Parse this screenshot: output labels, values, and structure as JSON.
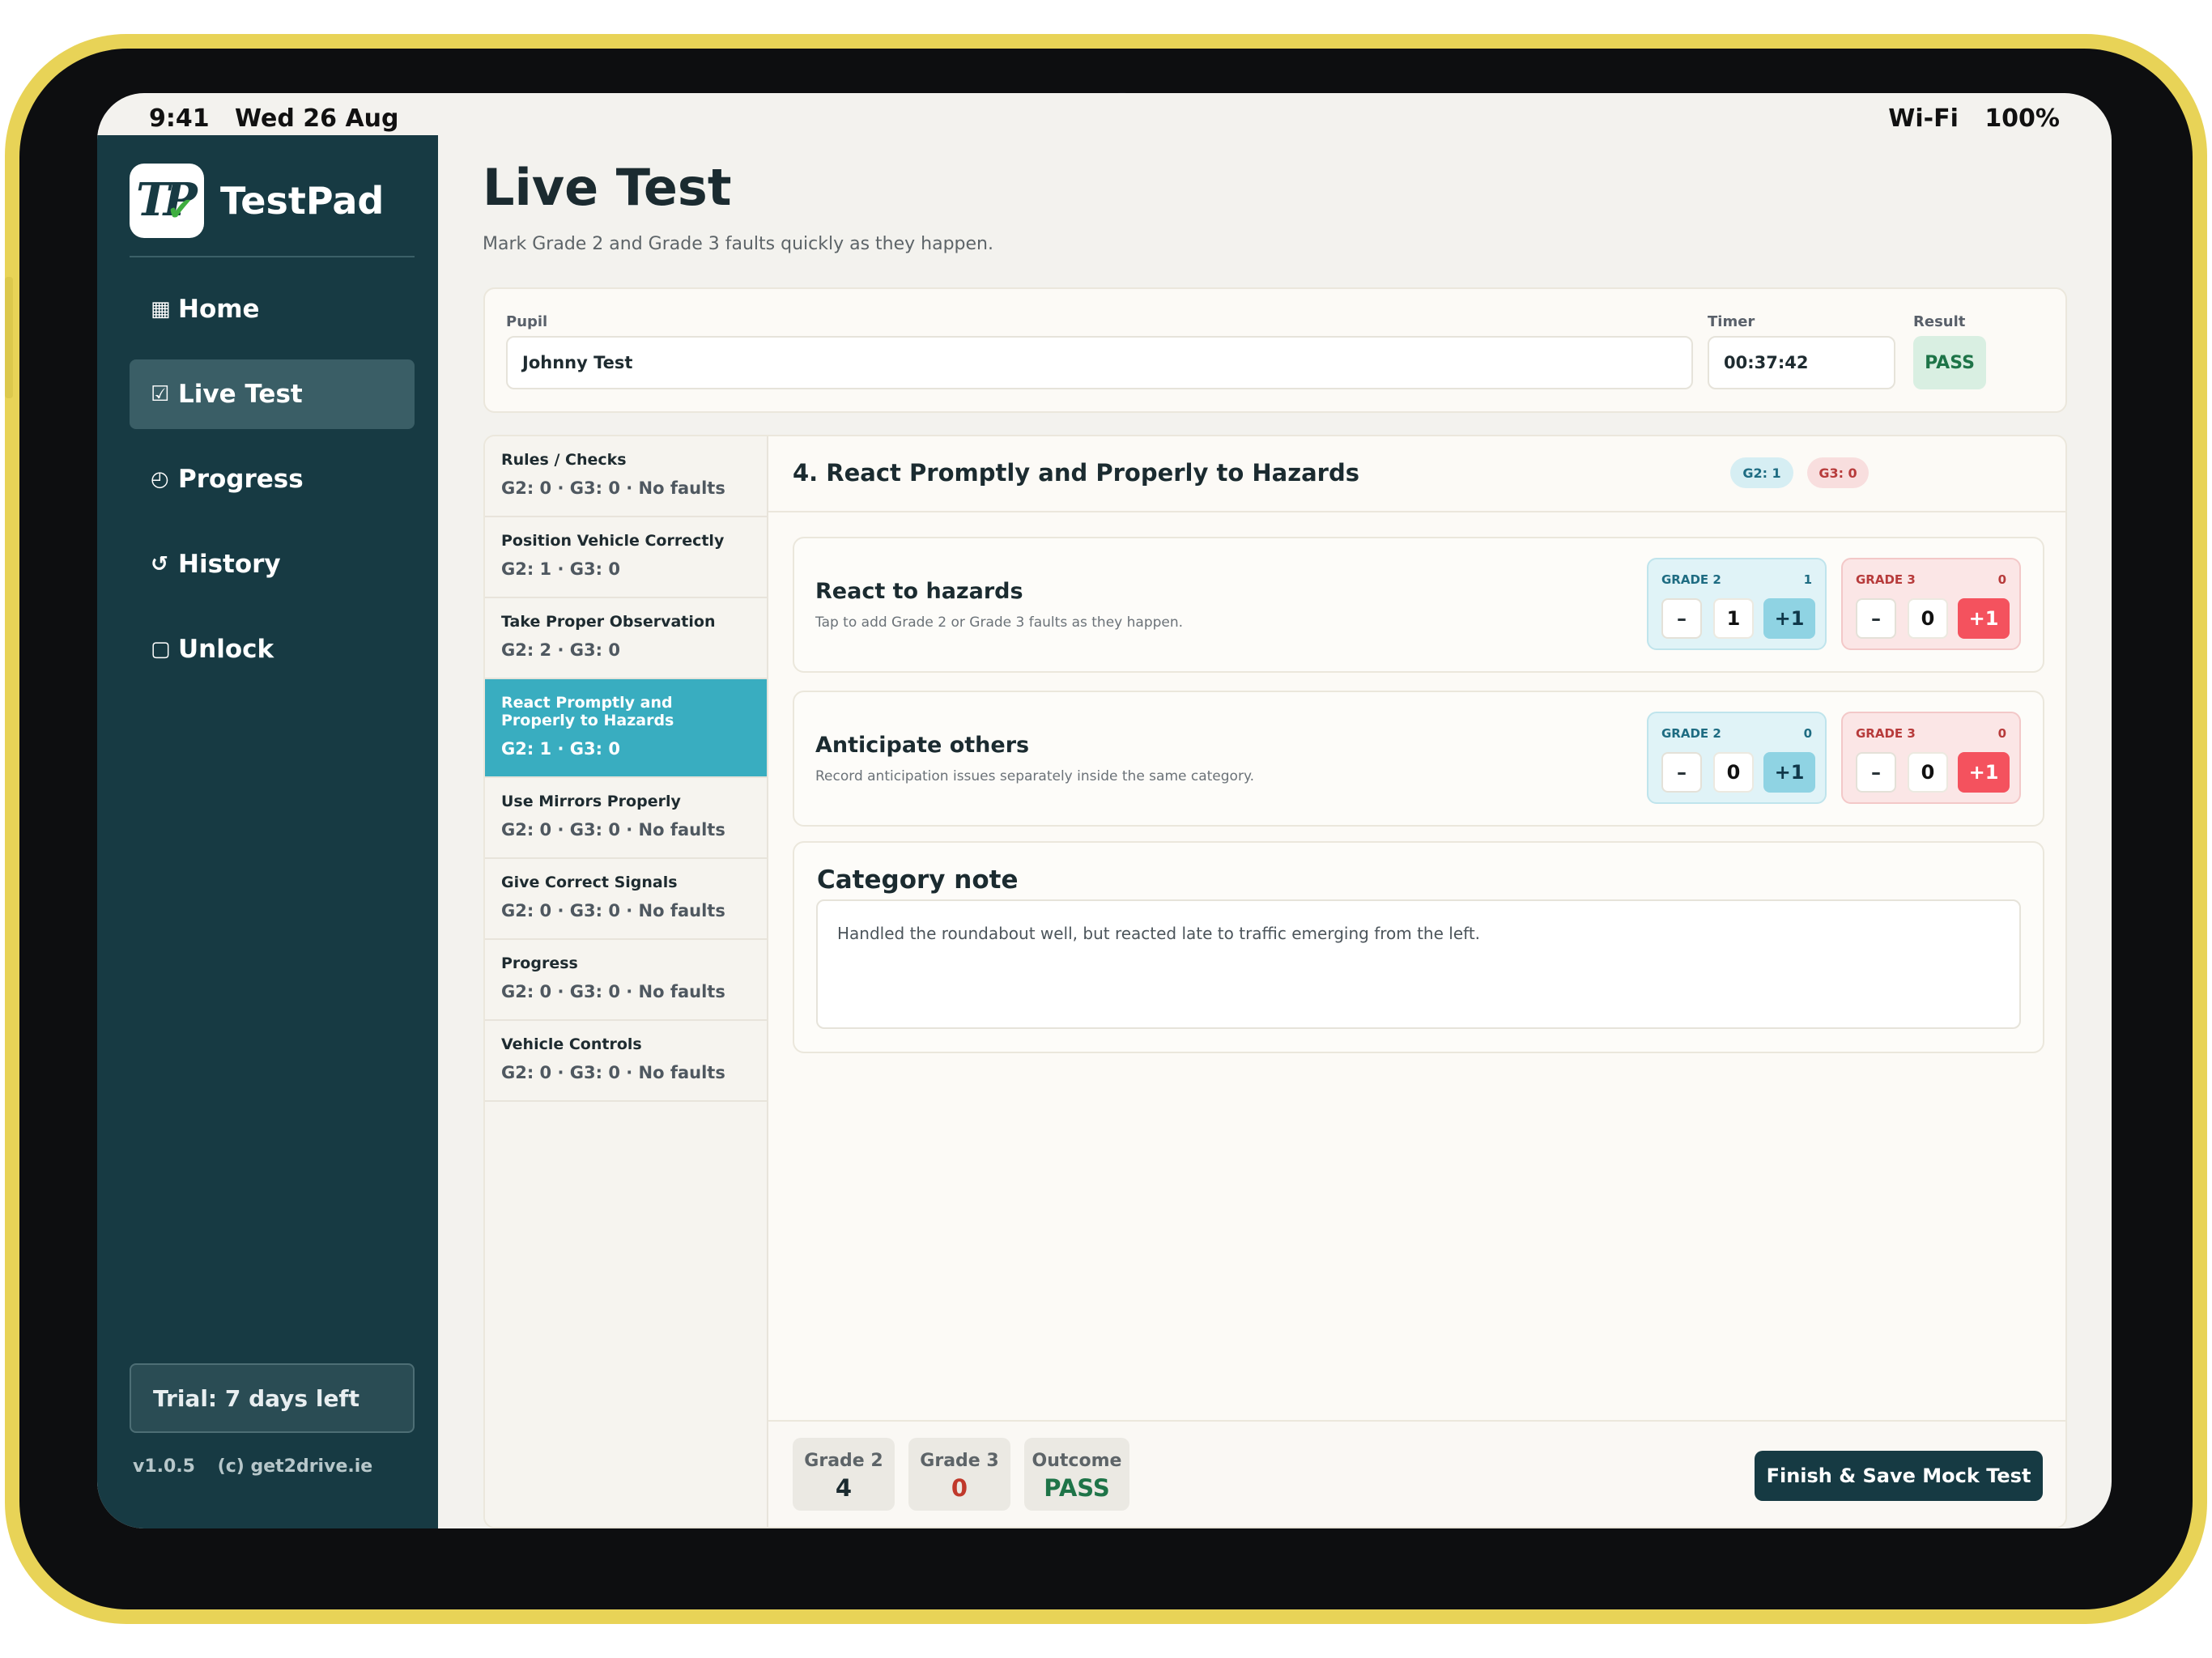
{
  "status": {
    "time": "9:41",
    "date": "Wed 26 Aug",
    "wifi": "Wi-Fi",
    "battery": "100%"
  },
  "brand": {
    "logo": "TP",
    "name": "TestPad"
  },
  "nav": [
    {
      "icon": "▦",
      "label": "Home"
    },
    {
      "icon": "☑",
      "label": "Live Test"
    },
    {
      "icon": "◴",
      "label": "Progress"
    },
    {
      "icon": "↺",
      "label": "History"
    },
    {
      "icon": "▢",
      "label": "Unlock"
    }
  ],
  "sidebar": {
    "trial": "Trial: 7 days left",
    "version": "v1.0.5",
    "copyright": "(c) get2drive.ie"
  },
  "page": {
    "title": "Live Test",
    "subtitle": "Mark Grade 2 and Grade 3 faults quickly as they happen."
  },
  "pupil": {
    "pupil_label": "Pupil",
    "pupil_value": "Johnny Test",
    "timer_label": "Timer",
    "timer_value": "00:37:42",
    "result_label": "Result",
    "result_value": "PASS"
  },
  "categories": [
    {
      "name": "Rules / Checks",
      "stat": "G2: 0 · G3: 0 · No faults"
    },
    {
      "name": "Position Vehicle Correctly",
      "stat": "G2: 1 · G3: 0"
    },
    {
      "name": "Take Proper Observation",
      "stat": "G2: 2 · G3: 0"
    },
    {
      "name": "React Promptly and Properly to Hazards",
      "stat": "G2: 1 · G3: 0"
    },
    {
      "name": "Use Mirrors Properly",
      "stat": "G2: 0 · G3: 0 · No faults"
    },
    {
      "name": "Give Correct Signals",
      "stat": "G2: 0 · G3: 0 · No faults"
    },
    {
      "name": "Progress",
      "stat": "G2: 0 · G3: 0 · No faults"
    },
    {
      "name": "Vehicle Controls",
      "stat": "G2: 0 · G3: 0 · No faults"
    }
  ],
  "detail": {
    "title": "4. React Promptly and Properly to Hazards",
    "g2_pill": "G2: 1",
    "g3_pill": "G3: 0",
    "faults": [
      {
        "title": "React to hazards",
        "desc": "Tap to add Grade 2 or Grade 3 faults as they happen.",
        "g2": {
          "label": "GRADE 2",
          "count": "1",
          "minus": "–",
          "value": "1",
          "plus": "+1"
        },
        "g3": {
          "label": "GRADE 3",
          "count": "0",
          "minus": "–",
          "value": "0",
          "plus": "+1"
        }
      },
      {
        "title": "Anticipate others",
        "desc": "Record anticipation issues separately inside the same category.",
        "g2": {
          "label": "GRADE 2",
          "count": "0",
          "minus": "–",
          "value": "0",
          "plus": "+1"
        },
        "g3": {
          "label": "GRADE 3",
          "count": "0",
          "minus": "–",
          "value": "0",
          "plus": "+1"
        }
      }
    ],
    "note_title": "Category note",
    "note_text": "Handled the roundabout well, but reacted late to traffic emerging from the left."
  },
  "summary": {
    "grade2_label": "Grade 2",
    "grade2_value": "4",
    "grade3_label": "Grade 3",
    "grade3_value": "0",
    "outcome_label": "Outcome",
    "outcome_value": "PASS",
    "finish_label": "Finish & Save Mock Test"
  },
  "colors": {
    "sidebar": "#173a43",
    "accent": "#39adc0",
    "grade2": "#1e6c82",
    "grade3": "#b73b3b",
    "pass": "#1e7448"
  }
}
